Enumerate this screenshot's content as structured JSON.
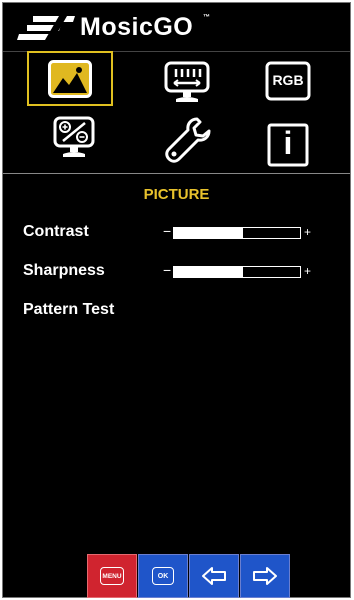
{
  "brand": {
    "name": "MosicGO",
    "trademark": "™"
  },
  "menu_icons": [
    {
      "id": "picture",
      "icon": "picture-icon",
      "selected": true
    },
    {
      "id": "display",
      "icon": "monitor-adjust-icon",
      "selected": false
    },
    {
      "id": "rgb",
      "icon": "rgb-icon",
      "label": "RGB",
      "selected": false
    },
    {
      "id": "color",
      "icon": "monitor-color-icon",
      "selected": false
    },
    {
      "id": "settings",
      "icon": "wrench-icon",
      "selected": false
    },
    {
      "id": "info",
      "icon": "info-icon",
      "label": "i",
      "selected": false
    }
  ],
  "section_title": "PICTURE",
  "settings": [
    {
      "label": "Contrast",
      "value_fraction": 0.55,
      "minus": "−",
      "plus": "+"
    },
    {
      "label": "Sharpness",
      "value_fraction": 0.55,
      "minus": "−",
      "plus": "+"
    },
    {
      "label": "Pattern Test"
    }
  ],
  "buttons": {
    "menu": "MENU",
    "ok": "OK",
    "left": "left-arrow-icon",
    "right": "right-arrow-icon"
  },
  "colors": {
    "accent": "#e8c22c",
    "menu_button": "#d0242f",
    "nav_button": "#1f55c9",
    "background": "#000000"
  }
}
